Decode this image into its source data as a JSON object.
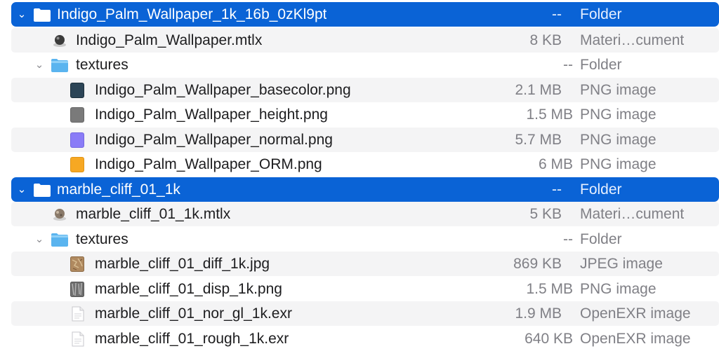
{
  "rows": [
    {
      "name": "Indigo_Palm_Wallpaper_1k_16b_0zKl9pt",
      "size": "--",
      "kind": "Folder"
    },
    {
      "name": "Indigo_Palm_Wallpaper.mtlx",
      "size": "8 KB",
      "kind": "Materi…cument"
    },
    {
      "name": "textures",
      "size": "--",
      "kind": "Folder"
    },
    {
      "name": "Indigo_Palm_Wallpaper_basecolor.png",
      "size": "2.1 MB",
      "kind": "PNG image",
      "icon_color": "#2c4557"
    },
    {
      "name": "Indigo_Palm_Wallpaper_height.png",
      "size": "1.5 MB",
      "kind": "PNG image",
      "icon_color": "#7a7a7a"
    },
    {
      "name": "Indigo_Palm_Wallpaper_normal.png",
      "size": "5.7 MB",
      "kind": "PNG image",
      "icon_color": "#8a7cf7"
    },
    {
      "name": "Indigo_Palm_Wallpaper_ORM.png",
      "size": "6 MB",
      "kind": "PNG image",
      "icon_color": "#f7a823"
    },
    {
      "name": "marble_cliff_01_1k",
      "size": "--",
      "kind": "Folder"
    },
    {
      "name": "marble_cliff_01_1k.mtlx",
      "size": "5 KB",
      "kind": "Materi…cument"
    },
    {
      "name": "textures",
      "size": "--",
      "kind": "Folder"
    },
    {
      "name": "marble_cliff_01_diff_1k.jpg",
      "size": "869 KB",
      "kind": "JPEG image",
      "icon_color": "#b08a60"
    },
    {
      "name": "marble_cliff_01_disp_1k.png",
      "size": "1.5 MB",
      "kind": "PNG image",
      "icon_color": "#6f6f6f"
    },
    {
      "name": "marble_cliff_01_nor_gl_1k.exr",
      "size": "1.9 MB",
      "kind": "OpenEXR image"
    },
    {
      "name": "marble_cliff_01_rough_1k.exr",
      "size": "640 KB",
      "kind": "OpenEXR image"
    }
  ],
  "icons": {
    "folder_color": "#5ab4ef",
    "folder_tab_color": "#8fd0f7",
    "selected_folder_color": "#ffffff"
  }
}
